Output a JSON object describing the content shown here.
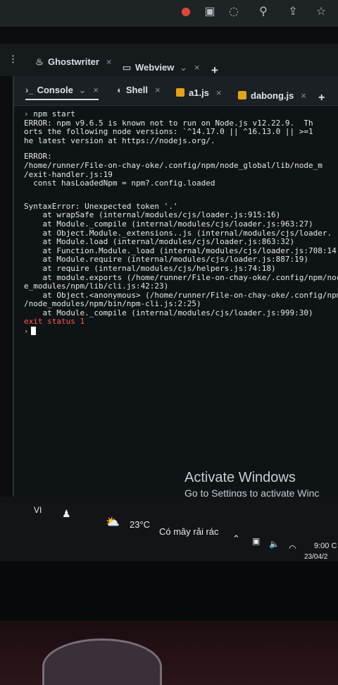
{
  "browser": {
    "top_icons": [
      "record-icon",
      "extension-icon",
      "bookmark-icon",
      "zoom-icon",
      "share-icon",
      "star-icon"
    ]
  },
  "tabs": [
    {
      "label": "Ghostwriter",
      "icon": "ghostwriter-icon",
      "close": "×"
    },
    {
      "label": "Webview",
      "icon": "webview-icon",
      "close": "×",
      "chevron": "⌄"
    }
  ],
  "new_tab": "+",
  "menu_dots": "⋮",
  "subtabs": [
    {
      "label": "Console",
      "icon": "console-icon",
      "close": "×",
      "chevron": "⌄"
    },
    {
      "label": "Shell",
      "icon": "shell-icon",
      "close": "×"
    },
    {
      "label": "a1.js",
      "icon": "js-file-icon",
      "close": "×"
    },
    {
      "label": "dabong.js",
      "icon": "js-file-icon",
      "close": "×"
    }
  ],
  "subtab_add": "+",
  "terminal": {
    "prompt_symbol": "›",
    "lines": [
      "npm start",
      "ERROR: npm v9.6.5 is known not to run on Node.js v12.22.9.  Th",
      "orts the following node versions: `^14.17.0 || ^16.13.0 || >=1",
      "he latest version at https://nodejs.org/.",
      "",
      "ERROR:",
      "/home/runner/File-on-chay-oke/.config/npm/node_global/lib/node_m",
      "/exit-handler.js:19",
      "  const hasLoadedNpm = npm?.config.loaded",
      "",
      "",
      "SyntaxError: Unexpected token '.'",
      "    at wrapSafe (internal/modules/cjs/loader.js:915:16)",
      "    at Module._compile (internal/modules/cjs/loader.js:963:27)",
      "    at Object.Module._extensions..js (internal/modules/cjs/loader.",
      "    at Module.load (internal/modules/cjs/loader.js:863:32)",
      "    at Function.Module._load (internal/modules/cjs/loader.js:708:14",
      "    at Module.require (internal/modules/cjs/loader.js:887:19)",
      "    at require (internal/modules/cjs/helpers.js:74:18)",
      "    at module.exports (/home/runner/File-on-chay-oke/.config/npm/noc",
      "e_modules/npm/lib/cli.js:42:23)",
      "    at Object.<anonymous> (/home/runner/File-on-chay-oke/.config/npm/",
      "/node_modules/npm/bin/npm-cli.js:2:25)",
      "    at Module._compile (internal/modules/cjs/loader.js:999:30)"
    ],
    "exit_status": "exit status 1",
    "input_prompt": "›"
  },
  "watermark": {
    "title": "Activate Windows",
    "subtitle": "Go to Settings to activate Winc"
  },
  "taskbar": {
    "language": "VI",
    "weather_temp": "23°C",
    "weather_desc": "Có mây rải rác",
    "time": "9:00 C",
    "date": "23/04/2",
    "tray_icons": [
      "chevron-up-icon",
      "meet-now-icon",
      "volume-icon",
      "wifi-icon"
    ]
  },
  "colors": {
    "prompt": "#e6b63c",
    "error_exit": "#ff5a4e",
    "terminal_bg": "#0e1316"
  }
}
